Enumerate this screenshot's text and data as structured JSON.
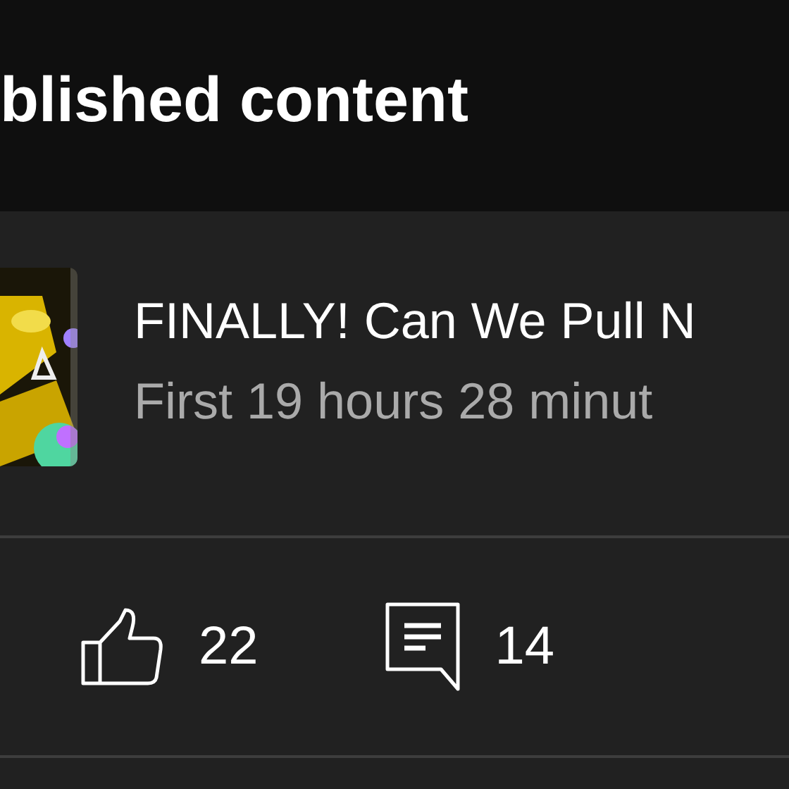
{
  "header": {
    "title": "blished content"
  },
  "video": {
    "title": "FINALLY! Can We Pull N",
    "subtitle": "First 19 hours 28 minut"
  },
  "stats": [
    {
      "kind": "likes",
      "count": "22"
    },
    {
      "kind": "comments",
      "count": "14"
    }
  ]
}
